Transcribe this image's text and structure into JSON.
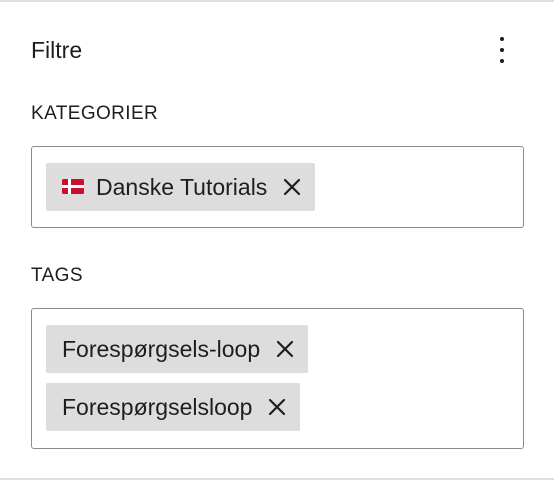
{
  "panel": {
    "title": "Filtre"
  },
  "categories": {
    "label": "KATEGORIER",
    "tokens": [
      {
        "text": "Danske Tutorials",
        "icon": "denmark-flag-icon"
      }
    ]
  },
  "tags": {
    "label": "TAGS",
    "tokens": [
      {
        "text": "Forespørgsels-loop"
      },
      {
        "text": "Forespørgselsloop"
      }
    ]
  },
  "colors": {
    "token_bg": "#dddddd",
    "border": "#8c8c8c",
    "text": "#1e1e1e",
    "flag_red": "#c8102e"
  }
}
